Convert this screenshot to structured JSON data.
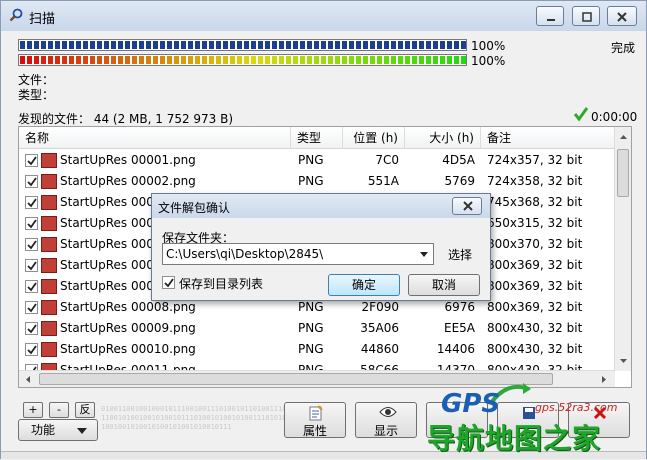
{
  "window": {
    "title": "扫描"
  },
  "progress": {
    "bar1_pct": 100,
    "bar1_label": "100%",
    "bar2_pct": 100,
    "bar2_label": "100%",
    "status": "完成"
  },
  "labels": {
    "file": "文件：",
    "type": "类型："
  },
  "found": {
    "text": "发现的文件： 44 (2 MB, 1 752 973 B)",
    "time": "0:00:00"
  },
  "table": {
    "headers": [
      "名称",
      "类型",
      "位置 (h)",
      "大小 (h)",
      "备注"
    ],
    "rows": [
      {
        "name": "StartUpRes 00001.png",
        "type": "PNG",
        "pos": "7C0",
        "size": "4D5A",
        "note": "724x357, 32 bit"
      },
      {
        "name": "StartUpRes 00002.png",
        "type": "PNG",
        "pos": "551A",
        "size": "5769",
        "note": "724x358, 32 bit"
      },
      {
        "name": "StartUpRes 00003.png",
        "type": "PNG",
        "pos": "",
        "size": "",
        "note": "745x368, 32 bit"
      },
      {
        "name": "StartUpRes 00004.png",
        "type": "PNG",
        "pos": "",
        "size": "",
        "note": "650x315, 32 bit"
      },
      {
        "name": "StartUpRes 00005.png",
        "type": "PNG",
        "pos": "",
        "size": "",
        "note": "800x370, 32 bit"
      },
      {
        "name": "StartUpRes 00006.png",
        "type": "PNG",
        "pos": "",
        "size": "",
        "note": "800x369, 32 bit"
      },
      {
        "name": "StartUpRes 00007.png",
        "type": "PNG",
        "pos": "",
        "size": "",
        "note": "800x369, 32 bit"
      },
      {
        "name": "StartUpRes 00008.png",
        "type": "PNG",
        "pos": "2F090",
        "size": "6976",
        "note": "800x369, 32 bit"
      },
      {
        "name": "StartUpRes 00009.png",
        "type": "PNG",
        "pos": "35A06",
        "size": "EE5A",
        "note": "800x430, 32 bit"
      },
      {
        "name": "StartUpRes 00010.png",
        "type": "PNG",
        "pos": "44860",
        "size": "14406",
        "note": "800x430, 32 bit"
      },
      {
        "name": "StartUpRes 00011.png",
        "type": "PNG",
        "pos": "58C66",
        "size": "14370",
        "note": "800x430, 32 bit"
      }
    ]
  },
  "small_buttons": {
    "add": "+",
    "remove": "-",
    "invert": "反"
  },
  "func_button": "功能",
  "buttons": {
    "properties": "属性",
    "display": "显示"
  },
  "binary_text": "0100110010010001011100100111010010110100111001010010011100101001001010010111010010100101001110101001001010101001001010010100101001010010111",
  "dialog": {
    "title": "文件解包确认",
    "folder_label": "保存文件夹：",
    "folder_value": "C:\\Users\\qi\\Desktop\\2845\\",
    "choose": "选择",
    "save_to_list": "保存到目录列表",
    "ok": "确定",
    "cancel": "取消"
  },
  "watermark": {
    "gps": "GPS",
    "url": "gps.52ra3.com",
    "cn": "导航地图之家"
  },
  "colors": {
    "progress_blue": "#1c3f93",
    "check_green": "#2bab2a",
    "accent": "#3c7fb1"
  }
}
